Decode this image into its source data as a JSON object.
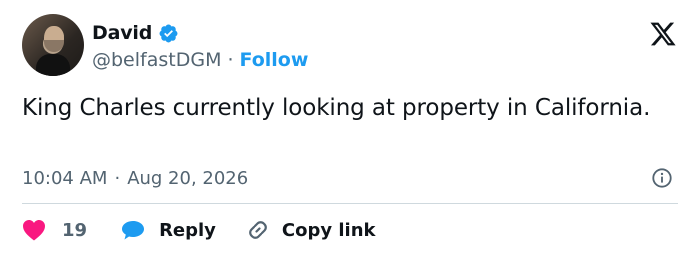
{
  "author": {
    "display_name": "David",
    "handle": "@belfastDGM",
    "separator": "·",
    "follow_label": "Follow",
    "verified_icon": "verified-badge-icon"
  },
  "tweet": {
    "text": "King Charles currently looking at property in California.",
    "time": "10:04 AM",
    "separator": "·",
    "date": "Aug 20, 2026"
  },
  "actions": {
    "like_count": "19",
    "reply_label": "Reply",
    "copy_link_label": "Copy link"
  },
  "colors": {
    "accent": "#1d9bf0",
    "like": "#f91880",
    "text": "#0f1419",
    "muted": "#536471",
    "divider": "#cfd9de"
  },
  "icons": [
    "x-logo-icon",
    "info-icon",
    "heart-icon",
    "speech-bubble-icon",
    "link-icon"
  ]
}
